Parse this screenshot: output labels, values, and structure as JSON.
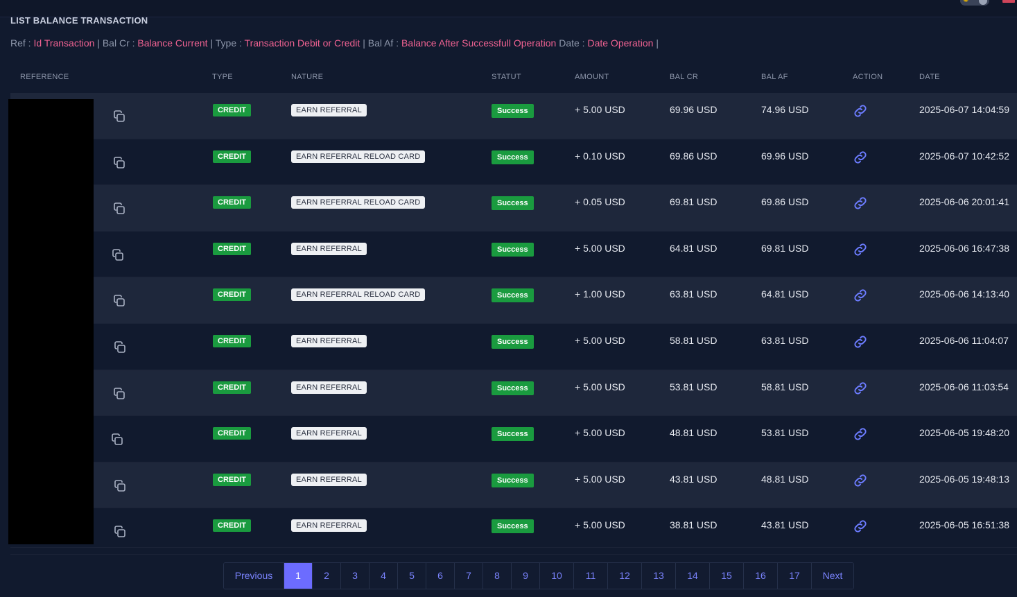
{
  "page": {
    "title": "LIST BALANCE TRANSACTION"
  },
  "legend": [
    {
      "key": "Ref :",
      "value": "Id Transaction",
      "sep": "|"
    },
    {
      "key": "Bal Cr :",
      "value": "Balance Current",
      "sep": "|"
    },
    {
      "key": "Type :",
      "value": "Transaction Debit or Credit",
      "sep": "|"
    },
    {
      "key": "Bal Af :",
      "value": "Balance After Successfull Operation",
      "sep": ""
    },
    {
      "key": "Date :",
      "value": "Date Operation",
      "sep": "|"
    }
  ],
  "columns": {
    "reference": "REFERENCE",
    "type": "TYPE",
    "nature": "NATURE",
    "statut": "STATUT",
    "amount": "AMOUNT",
    "bal_cr": "BAL CR",
    "bal_af": "BAL AF",
    "action": "ACTION",
    "date": "DATE"
  },
  "rows": [
    {
      "type": "CREDIT",
      "nature": "EARN REFERRAL",
      "status": "Success",
      "amount": "+ 5.00 USD",
      "bal_cr": "69.96 USD",
      "bal_af": "74.96 USD",
      "date": "2025-06-07 14:04:59"
    },
    {
      "type": "CREDIT",
      "nature": "EARN REFERRAL RELOAD CARD",
      "status": "Success",
      "amount": "+ 0.10 USD",
      "bal_cr": "69.86 USD",
      "bal_af": "69.96 USD",
      "date": "2025-06-07 10:42:52"
    },
    {
      "type": "CREDIT",
      "nature": "EARN REFERRAL RELOAD CARD",
      "status": "Success",
      "amount": "+ 0.05 USD",
      "bal_cr": "69.81 USD",
      "bal_af": "69.86 USD",
      "date": "2025-06-06 20:01:41"
    },
    {
      "type": "CREDIT",
      "nature": "EARN REFERRAL",
      "status": "Success",
      "amount": "+ 5.00 USD",
      "bal_cr": "64.81 USD",
      "bal_af": "69.81 USD",
      "date": "2025-06-06 16:47:38"
    },
    {
      "type": "CREDIT",
      "nature": "EARN REFERRAL RELOAD CARD",
      "status": "Success",
      "amount": "+ 1.00 USD",
      "bal_cr": "63.81 USD",
      "bal_af": "64.81 USD",
      "date": "2025-06-06 14:13:40"
    },
    {
      "type": "CREDIT",
      "nature": "EARN REFERRAL",
      "status": "Success",
      "amount": "+ 5.00 USD",
      "bal_cr": "58.81 USD",
      "bal_af": "63.81 USD",
      "date": "2025-06-06 11:04:07"
    },
    {
      "type": "CREDIT",
      "nature": "EARN REFERRAL",
      "status": "Success",
      "amount": "+ 5.00 USD",
      "bal_cr": "53.81 USD",
      "bal_af": "58.81 USD",
      "date": "2025-06-06 11:03:54"
    },
    {
      "type": "CREDIT",
      "nature": "EARN REFERRAL",
      "status": "Success",
      "amount": "+ 5.00 USD",
      "bal_cr": "48.81 USD",
      "bal_af": "53.81 USD",
      "date": "2025-06-05 19:48:20"
    },
    {
      "type": "CREDIT",
      "nature": "EARN REFERRAL",
      "status": "Success",
      "amount": "+ 5.00 USD",
      "bal_cr": "43.81 USD",
      "bal_af": "48.81 USD",
      "date": "2025-06-05 19:48:13"
    },
    {
      "type": "CREDIT",
      "nature": "EARN REFERRAL",
      "status": "Success",
      "amount": "+ 5.00 USD",
      "bal_cr": "38.81 USD",
      "bal_af": "43.81 USD",
      "date": "2025-06-05 16:51:38"
    }
  ],
  "pagination": {
    "previous": "Previous",
    "next": "Next",
    "pages": [
      "1",
      "2",
      "3",
      "4",
      "5",
      "6",
      "7",
      "8",
      "9",
      "10",
      "11",
      "12",
      "13",
      "14",
      "15",
      "16",
      "17"
    ],
    "current": "1"
  },
  "colors": {
    "background": "#111a2e",
    "accent": "#6c6cff",
    "legend_value": "#f06292",
    "success": "#1a9b3f"
  },
  "icons": {
    "copy": "copy-icon",
    "link": "link-icon"
  }
}
